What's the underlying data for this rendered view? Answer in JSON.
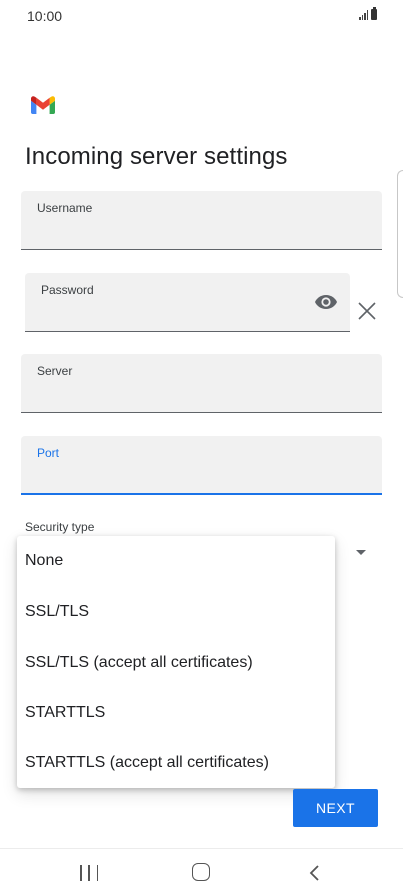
{
  "status_bar": {
    "time": "10:00"
  },
  "page": {
    "title": "Incoming server settings"
  },
  "fields": {
    "username": {
      "label": "Username",
      "value": ""
    },
    "password": {
      "label": "Password",
      "value": ""
    },
    "server": {
      "label": "Server",
      "value": ""
    },
    "port": {
      "label": "Port",
      "value": ""
    }
  },
  "security": {
    "label": "Security type",
    "options": [
      "None",
      "SSL/TLS",
      "SSL/TLS (accept all certificates)",
      "STARTTLS",
      "STARTTLS (accept all certificates)"
    ]
  },
  "buttons": {
    "next": "NEXT"
  },
  "icons": {
    "logo": "gmail-logo",
    "password_toggle": "eye-icon",
    "clear": "close-icon",
    "dropdown": "dropdown-arrow-icon",
    "nav": [
      "recents-icon",
      "home-icon",
      "back-icon"
    ]
  },
  "colors": {
    "accent": "#1a73e8",
    "field_background": "#f1f1f1",
    "text": "#202124"
  }
}
